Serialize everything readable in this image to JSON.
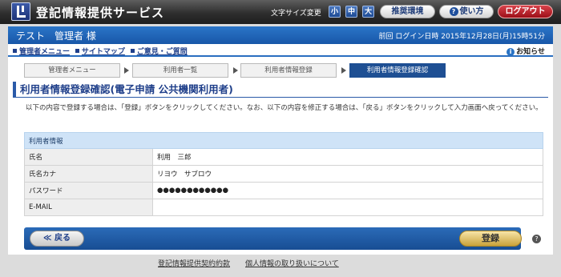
{
  "header": {
    "site_title": "登記情報提供サービス",
    "font_size_label": "文字サイズ変更",
    "font_sizes": [
      "小",
      "中",
      "大"
    ],
    "env_button": "推奨環境",
    "usage_button": "使い方",
    "usage_icon_char": "?",
    "logout_button": "ログアウト"
  },
  "userbar": {
    "user_name": "テスト　管理者 様",
    "last_login": "前回 ログイン日時 2015年12月28日(月)15時51分"
  },
  "nav": {
    "links": [
      "管理者メニュー",
      "サイトマップ",
      "ご意見・ご質問"
    ],
    "notice_label": "お知らせ",
    "notice_icon_char": "i"
  },
  "steps": [
    "管理者メニュー",
    "利用者一覧",
    "利用者情報登録",
    "利用者情報登録確認"
  ],
  "page_title": "利用者情報登録確認(電子申請 公共機関利用者)",
  "instruction": "以下の内容で登録する場合は、「登録」ボタンをクリックしてください。なお、以下の内容を修正する場合は、「戻る」ボタンをクリックして入力画面へ戻ってください。",
  "user_info": {
    "section_title": "利用者情報",
    "rows": [
      {
        "label": "氏名",
        "value": "利用　三郎"
      },
      {
        "label": "氏名カナ",
        "value": "リヨウ　サブロウ"
      },
      {
        "label": "パスワード",
        "value": "●●●●●●●●●●●●"
      },
      {
        "label": "E-MAIL",
        "value": ""
      }
    ]
  },
  "actions": {
    "back_label": "≪ 戻る",
    "register_label": "登録",
    "help_char": "?"
  },
  "footer": {
    "links": [
      "登記情報提供契約約款",
      "個人情報の取り扱いについて"
    ]
  },
  "colors": {
    "header_blue": "#1857a8",
    "logout_red": "#9c0f18",
    "register_gold": "#c9a23a"
  }
}
